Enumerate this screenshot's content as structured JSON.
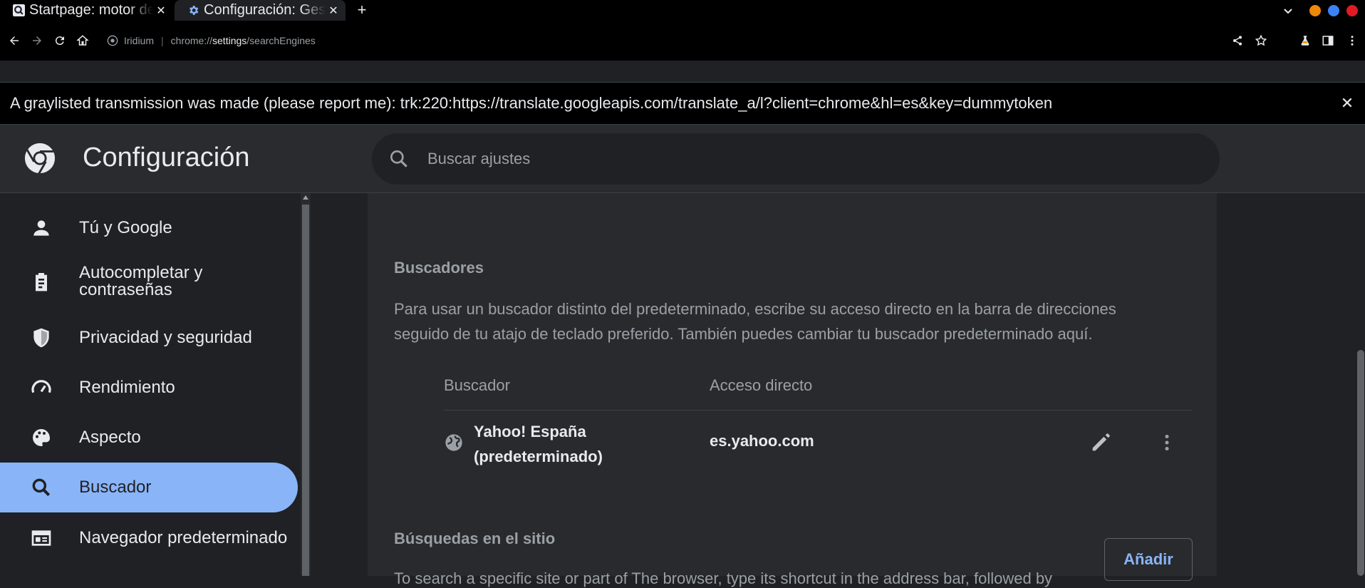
{
  "tabs": [
    {
      "title": "Startpage: motor de búsqueda privado",
      "active": false
    },
    {
      "title": "Configuración: Gestionar buscadores",
      "active": true
    }
  ],
  "toolbar": {
    "site_chip": "Iridium",
    "url_scheme": "chrome://",
    "url_host": "settings",
    "url_path": "/searchEngines"
  },
  "window_buttons": {
    "colors": [
      "#f0880a",
      "#3b82f6",
      "#e01b24"
    ]
  },
  "infobar": {
    "message": "A graylisted transmission was made (please report me): trk:220:https://translate.googleapis.com/translate_a/l?client=chrome&hl=es&key=dummytoken",
    "close": "✕"
  },
  "header": {
    "title": "Configuración",
    "search_placeholder": "Buscar ajustes"
  },
  "sidebar": {
    "items": [
      {
        "label": "Tú y Google",
        "icon": "person-icon"
      },
      {
        "label": "Autocompletar y contraseñas",
        "icon": "clipboard-icon"
      },
      {
        "label": "Privacidad y seguridad",
        "icon": "shield-icon"
      },
      {
        "label": "Rendimiento",
        "icon": "speedometer-icon"
      },
      {
        "label": "Aspecto",
        "icon": "palette-icon"
      },
      {
        "label": "Buscador",
        "icon": "search-icon",
        "active": true
      },
      {
        "label": "Navegador predeterminado",
        "icon": "browser-icon"
      }
    ]
  },
  "main": {
    "section_title": "Buscadores",
    "description": "Para usar un buscador distinto del predeterminado, escribe su acceso directo en la barra de direcciones seguido de tu atajo de teclado preferido. También puedes cambiar tu buscador predeterminado aquí.",
    "columns": [
      "Buscador",
      "Acceso directo"
    ],
    "engines": [
      {
        "name_line1": "Yahoo! España",
        "name_line2": "(predeterminado)",
        "shortcut": "es.yahoo.com"
      }
    ],
    "site_search_title": "Búsquedas en el sitio",
    "add_label": "Añadir",
    "site_search_desc": "To search a specific site or part of The browser, type its shortcut in the address bar, followed by"
  }
}
